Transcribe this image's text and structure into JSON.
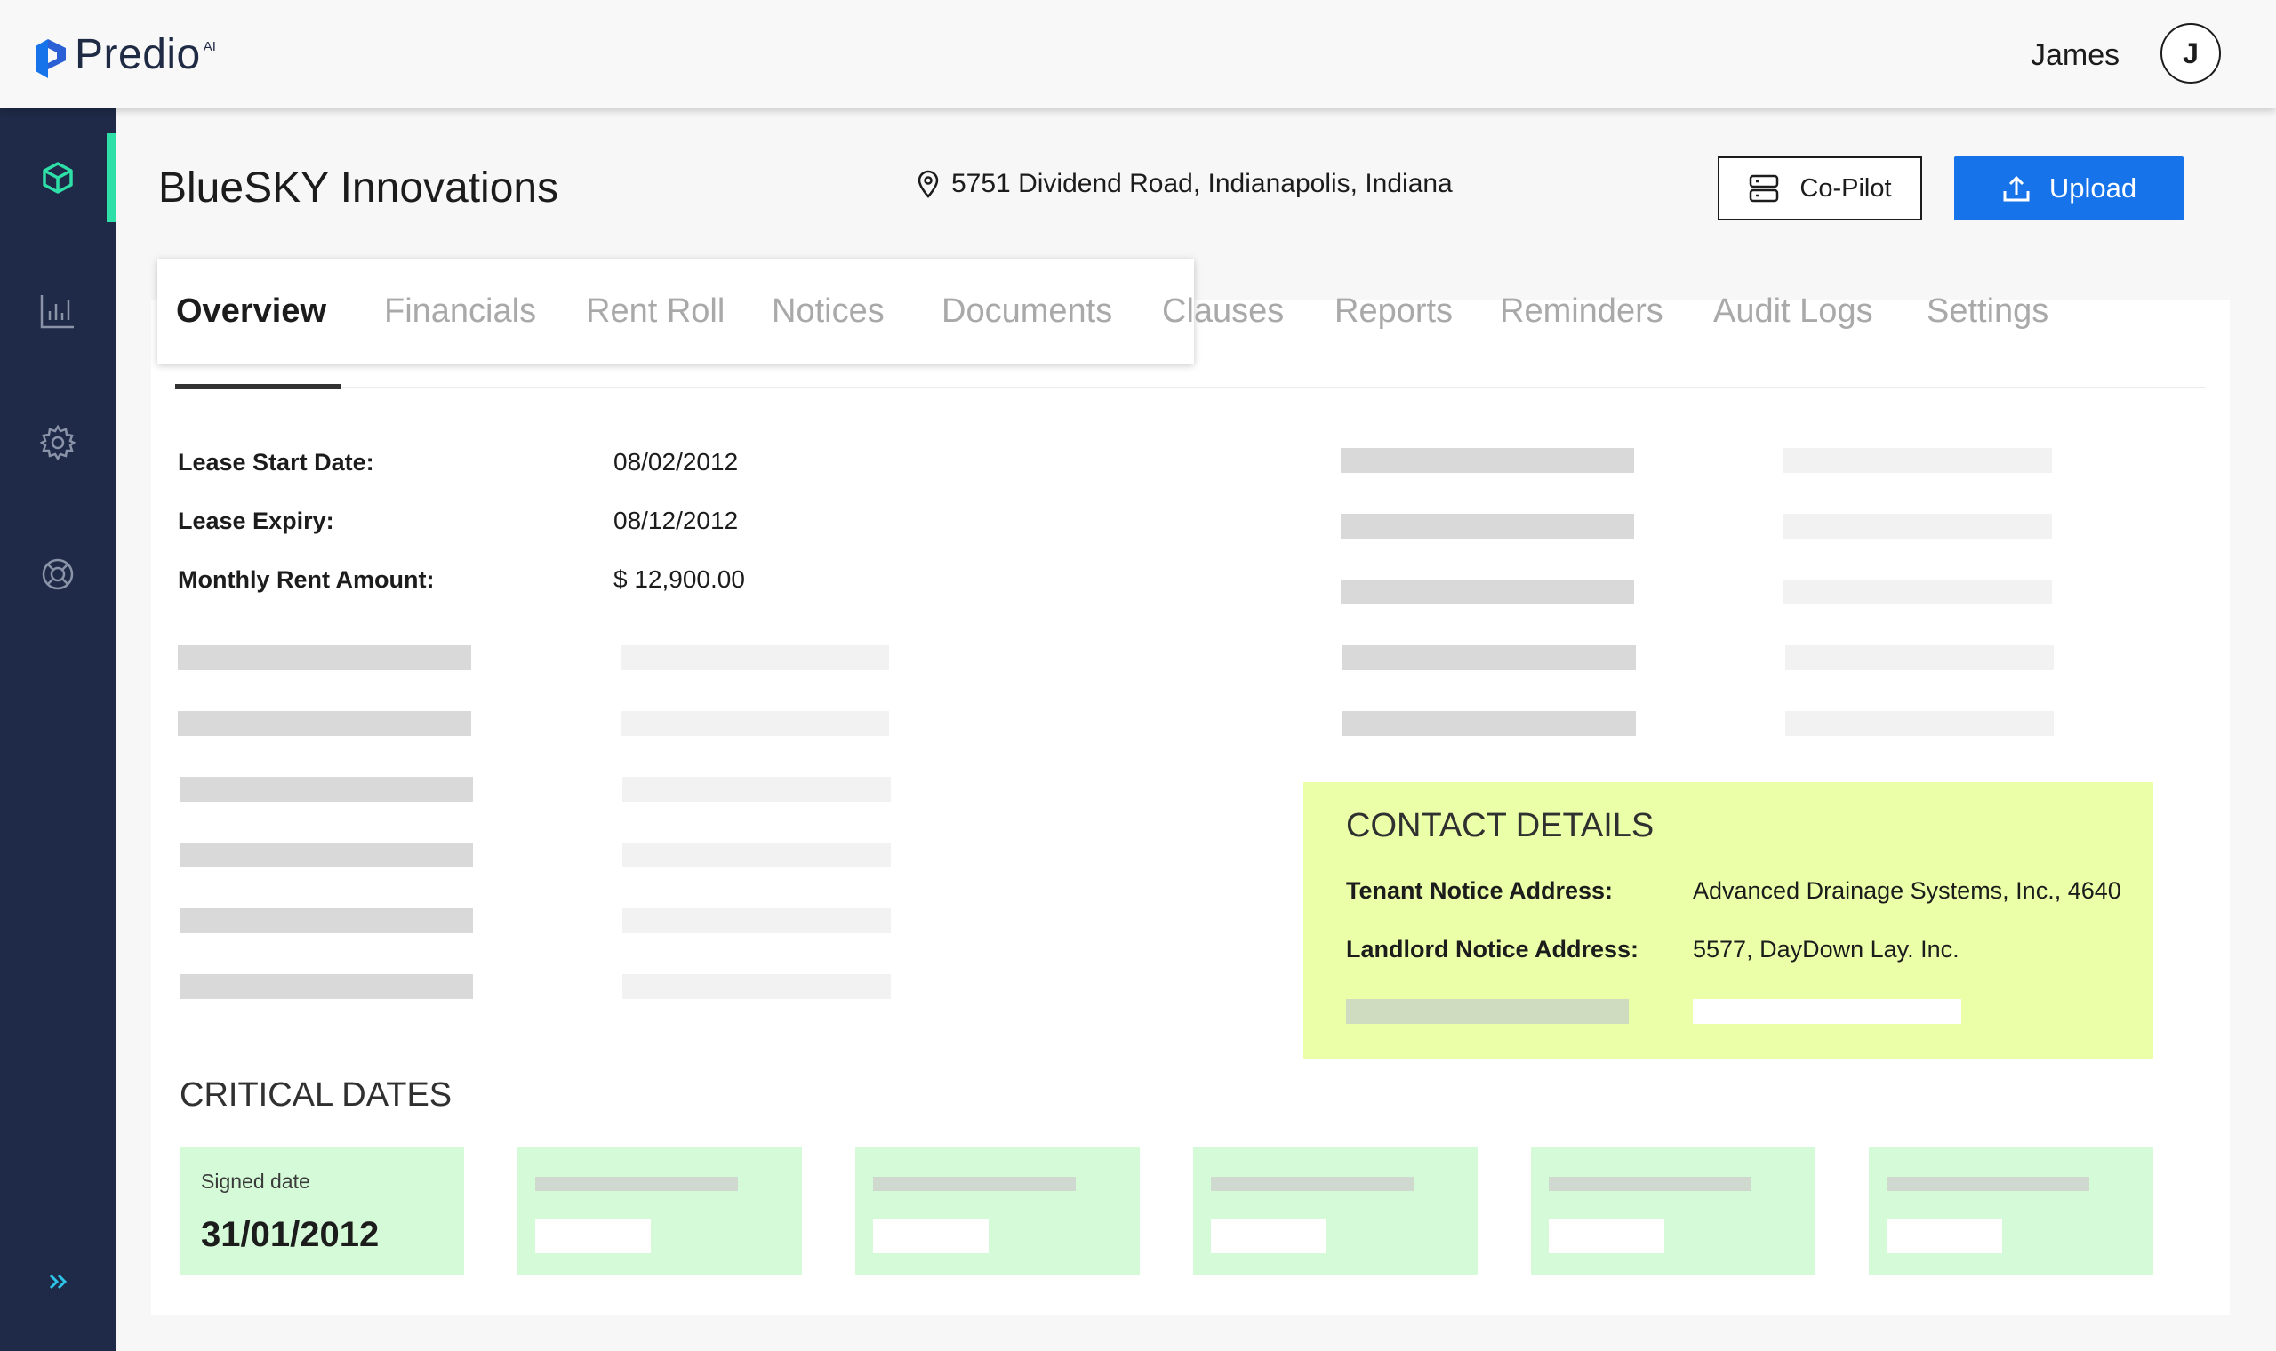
{
  "app": {
    "logo_text": "Predio",
    "logo_sup": "AI",
    "user_name": "James",
    "avatar_initial": "J"
  },
  "property": {
    "title": "BlueSKY Innovations",
    "address": "5751 Dividend Road, Indianapolis, Indiana"
  },
  "actions": {
    "copilot_label": "Co-Pilot",
    "upload_label": "Upload"
  },
  "tabs": [
    {
      "label": "Overview",
      "active": true
    },
    {
      "label": "Financials"
    },
    {
      "label": "Rent Roll"
    },
    {
      "label": "Notices"
    },
    {
      "label": "Documents"
    },
    {
      "label": "Clauses"
    },
    {
      "label": "Reports"
    },
    {
      "label": "Reminders"
    },
    {
      "label": "Audit Logs"
    },
    {
      "label": "Settings"
    }
  ],
  "lease": {
    "start_label": "Lease Start Date:",
    "start_value": "08/02/2012",
    "expiry_label": "Lease Expiry:",
    "expiry_value": "08/12/2012",
    "rent_label": "Monthly Rent Amount:",
    "rent_value": "$ 12,900.00"
  },
  "contact": {
    "title": "CONTACT DETAILS",
    "tenant_label": "Tenant Notice Address:",
    "tenant_value": "Advanced Drainage Systems, Inc., 4640",
    "landlord_label": "Landlord Notice Address:",
    "landlord_value": "5577, DayDown Lay. Inc."
  },
  "critical_dates": {
    "title": "CRITICAL DATES",
    "signed_label": "Signed date",
    "signed_value": "31/01/2012"
  },
  "sidebar": {
    "items": [
      "cube-icon",
      "bar-chart-icon",
      "gear-icon",
      "lifebuoy-icon"
    ],
    "expand": "double-chevron-right-icon"
  },
  "colors": {
    "sidebar_bg": "#1e2a47",
    "accent_green": "#2ee0a8",
    "upload_blue": "#1673ea",
    "contact_bg": "#eaffa7",
    "date_card_bg": "#d4fad8",
    "logo_blue": "#1673ea"
  }
}
